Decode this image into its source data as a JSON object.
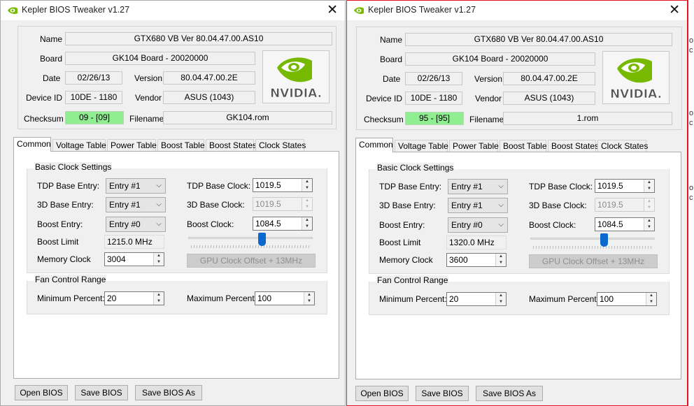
{
  "windows": [
    {
      "title": "Kepler BIOS Tweaker v1.27",
      "close": "✕",
      "info": {
        "name_label": "Name",
        "name": "GTX680 VB Ver 80.04.47.00.AS10",
        "board_label": "Board",
        "board": "GK104 Board - 20020000",
        "date_label": "Date",
        "date": "02/26/13",
        "version_label": "Version",
        "version": "80.04.47.00.2E",
        "device_label": "Device ID",
        "device": "10DE - 1180",
        "vendor_label": "Vendor",
        "vendor": "ASUS (1043)",
        "checksum_label": "Checksum",
        "checksum": "09 - [09]",
        "filename_label": "Filename",
        "filename": "GK104.rom",
        "logo_text": "NVIDIA."
      },
      "tabs": [
        "Common",
        "Voltage Table",
        "Power Table",
        "Boost Table",
        "Boost States",
        "Clock States"
      ],
      "clock": {
        "group_title": "Basic Clock Settings",
        "tdp_entry_label": "TDP Base Entry:",
        "tdp_entry": "Entry #1",
        "d3_entry_label": "3D Base Entry:",
        "d3_entry": "Entry #1",
        "boost_entry_label": "Boost Entry:",
        "boost_entry": "Entry #0",
        "boost_limit_label": "Boost Limit",
        "boost_limit": "1215.0 MHz",
        "memory_label": "Memory Clock",
        "memory": "3004",
        "tdp_clock_label": "TDP Base Clock:",
        "tdp_clock": "1019.5",
        "d3_clock_label": "3D Base Clock:",
        "d3_clock": "1019.5",
        "boost_clock_label": "Boost Clock:",
        "boost_clock": "1084.5",
        "offset_button": "GPU Clock Offset + 13MHz",
        "slider_fraction": 0.59
      },
      "fan": {
        "group_title": "Fan Control Range",
        "min_label": "Minimum Percent:",
        "min": "20",
        "max_label": "Maximum Percent:",
        "max": "100"
      },
      "buttons": {
        "open": "Open BIOS",
        "save": "Save BIOS",
        "save_as": "Save BIOS As"
      }
    },
    {
      "title": "Kepler BIOS Tweaker v1.27",
      "close": "✕",
      "info": {
        "name_label": "Name",
        "name": "GTX680 VB Ver 80.04.47.00.AS10",
        "board_label": "Board",
        "board": "GK104 Board - 20020000",
        "date_label": "Date",
        "date": "02/26/13",
        "version_label": "Version",
        "version": "80.04.47.00.2E",
        "device_label": "Device ID",
        "device": "10DE - 1180",
        "vendor_label": "Vendor",
        "vendor": "ASUS (1043)",
        "checksum_label": "Checksum",
        "checksum": "95 - [95]",
        "filename_label": "Filename",
        "filename": "1.rom",
        "logo_text": "NVIDIA."
      },
      "tabs": [
        "Common",
        "Voltage Table",
        "Power Table",
        "Boost Table",
        "Boost States",
        "Clock States"
      ],
      "clock": {
        "group_title": "Basic Clock Settings",
        "tdp_entry_label": "TDP Base Entry:",
        "tdp_entry": "Entry #1",
        "d3_entry_label": "3D Base Entry:",
        "d3_entry": "Entry #1",
        "boost_entry_label": "Boost Entry:",
        "boost_entry": "Entry #0",
        "boost_limit_label": "Boost Limit",
        "boost_limit": "1320.0 MHz",
        "memory_label": "Memory Clock",
        "memory": "3600",
        "tdp_clock_label": "TDP Base Clock:",
        "tdp_clock": "1019.5",
        "d3_clock_label": "3D Base Clock:",
        "d3_clock": "1019.5",
        "boost_clock_label": "Boost Clock:",
        "boost_clock": "1084.5",
        "offset_button": "GPU Clock Offset + 13MHz",
        "slider_fraction": 0.59
      },
      "fan": {
        "group_title": "Fan Control Range",
        "min_label": "Minimum Percent:",
        "min": "20",
        "max_label": "Maximum Percent:",
        "max": "100"
      },
      "buttons": {
        "open": "Open BIOS",
        "save": "Save BIOS",
        "save_as": "Save BIOS As"
      }
    }
  ],
  "background_sliver": [
    "o",
    "c",
    "o",
    "c",
    "o",
    "c"
  ]
}
